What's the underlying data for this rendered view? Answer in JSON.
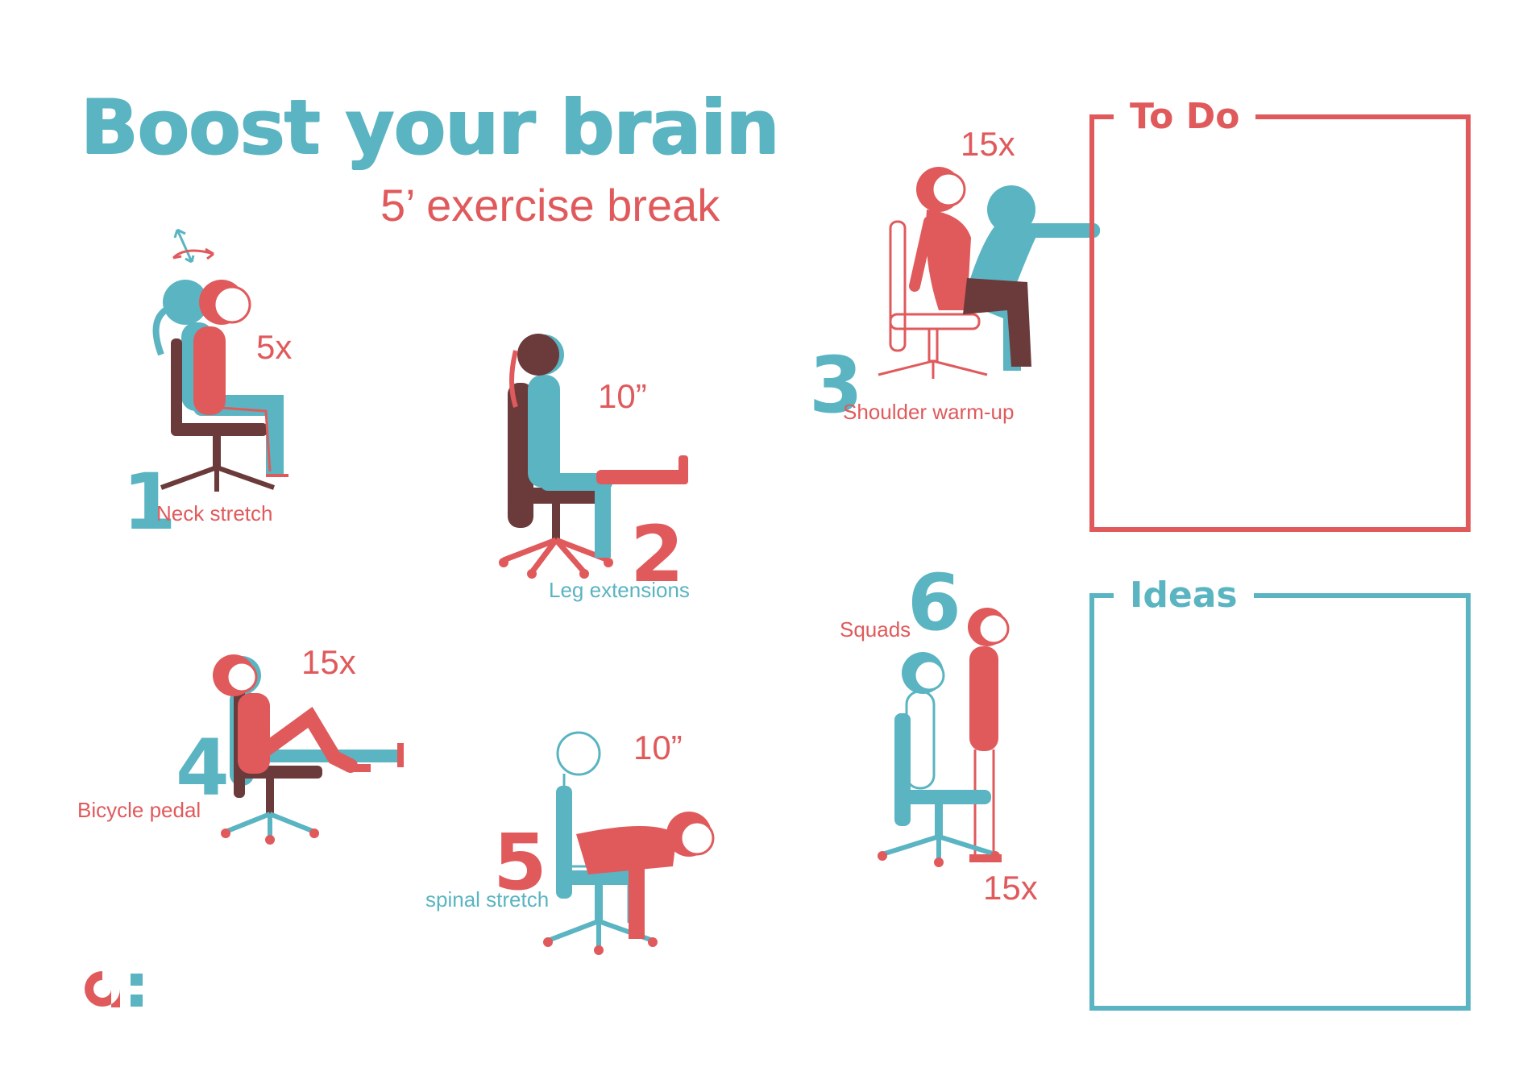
{
  "title": "Boost your brain",
  "subtitle": "5’ exercise break",
  "exercises": [
    {
      "number": "1",
      "name": "Neck stretch",
      "reps": "5x"
    },
    {
      "number": "2",
      "name": "Leg extensions",
      "reps": "10”"
    },
    {
      "number": "3",
      "name": "Shoulder warm-up",
      "reps": "15x"
    },
    {
      "number": "4",
      "name": "Bicycle pedal",
      "reps": "15x"
    },
    {
      "number": "5",
      "name": "spinal stretch",
      "reps": "10”"
    },
    {
      "number": "6",
      "name": "Squads",
      "reps": "15x"
    }
  ],
  "boxes": {
    "todo": {
      "title": "To Do",
      "color": "#e05a5c"
    },
    "ideas": {
      "title": "Ideas",
      "color": "#5ab4c2"
    }
  },
  "colors": {
    "teal": "#5ab4c2",
    "red": "#e05a5c",
    "dark": "#6b3a3a"
  },
  "logo": {
    "icon": "brand-logo-icon"
  }
}
